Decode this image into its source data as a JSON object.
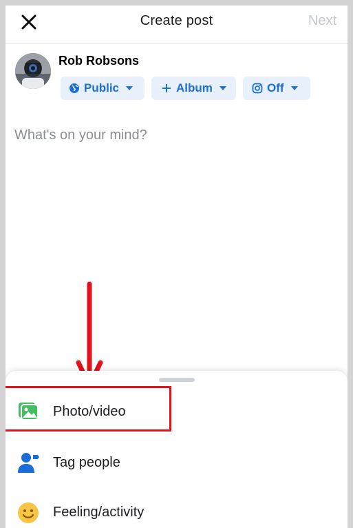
{
  "header": {
    "title": "Create post",
    "next_label": "Next"
  },
  "author": {
    "name": "Rob Robsons"
  },
  "chips": {
    "audience": "Public",
    "album": "Album",
    "instagram": "Off"
  },
  "composer": {
    "placeholder": "What's on your mind?"
  },
  "sheet": {
    "items": [
      {
        "label": "Photo/video",
        "icon": "photo-video-icon"
      },
      {
        "label": "Tag people",
        "icon": "tag-people-icon"
      },
      {
        "label": "Feeling/activity",
        "icon": "feeling-activity-icon"
      }
    ]
  },
  "colors": {
    "brand_blue": "#1a6ed8",
    "chip_bg": "#e7f0fb",
    "photo_green": "#45bd62",
    "feeling_yellow": "#f7c544",
    "annotation_red": "#e2131a",
    "disabled_text": "#c4c7cc"
  }
}
